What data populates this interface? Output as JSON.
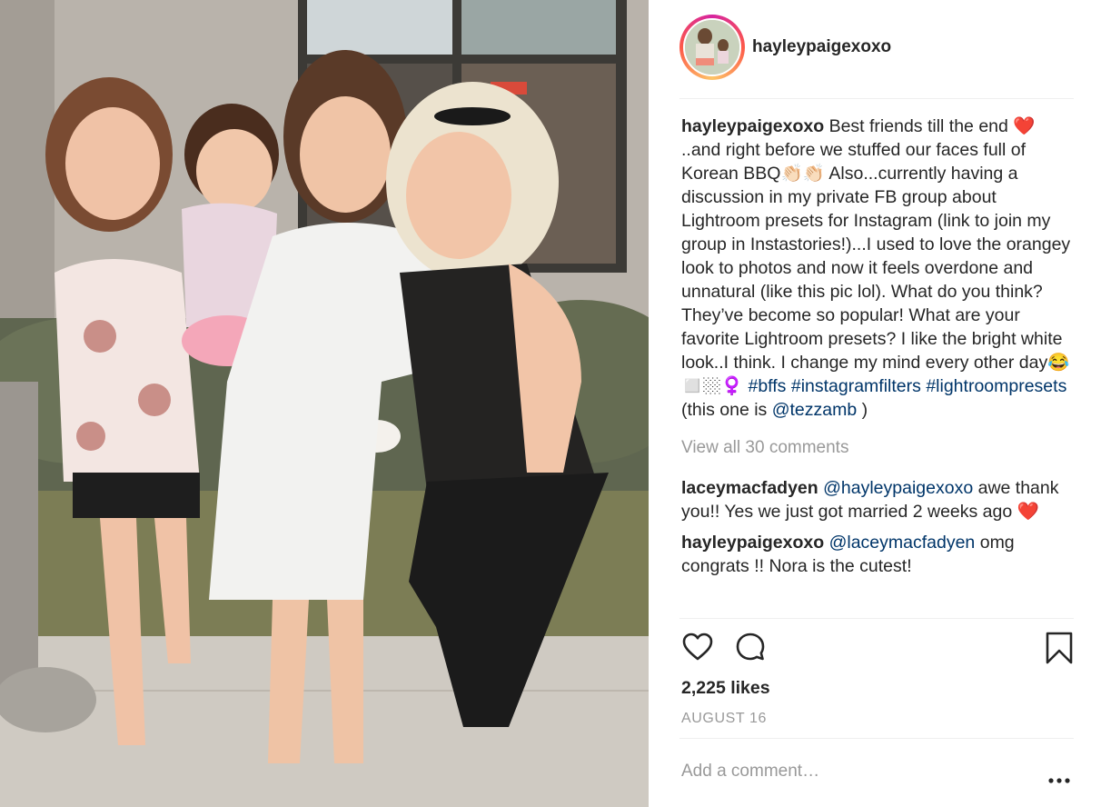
{
  "post": {
    "username": "hayleypaigexoxo",
    "caption_parts": {
      "line1": "Best friends till the end",
      "heart": "❤️",
      "line2": "..and right before we stuffed our faces full of Korean BBQ",
      "clap": "👏🏻👏🏻",
      "line3": "Also...currently having a discussion in my private FB group about Lightroom presets for Instagram (link to join my group in Instastories!)...I used to love the orangey look to photos and now it feels overdone and unnatural (like this pic lol). What do you think? They’ve become so popular! What are your favorite Lightroom presets? I like the bright white look..I think. I change my mind every other day",
      "emojis": "😂◻️🏼‍♀️",
      "hashtag1": "#bffs",
      "hashtag2": "#instagramfilters",
      "hashtag3": "#lightroompresets",
      "credit_prefix": "(this one is",
      "credit_mention": "@tezzamb",
      "credit_suffix": ")"
    },
    "view_all_comments": "View all 30 comments",
    "comments": [
      {
        "username": "laceymacfadyen",
        "mention": "@hayleypaigexoxo",
        "text": "awe thank you!! Yes we just got married 2 weeks ago",
        "emoji": "❤️"
      },
      {
        "username": "hayleypaigexoxo",
        "mention": "@laceymacfadyen",
        "text": "omg congrats !! Nora is the cutest!"
      }
    ],
    "likes": "2,225 likes",
    "date": "AUGUST 16",
    "add_comment_placeholder": "Add a comment…"
  },
  "icons": {
    "like": "heart-outline-icon",
    "comment": "speech-bubble-icon",
    "save": "bookmark-icon",
    "more": "ellipsis-icon"
  },
  "colors": {
    "link": "#003569",
    "muted": "#999999",
    "text": "#262626",
    "heart": "#e0245e"
  }
}
